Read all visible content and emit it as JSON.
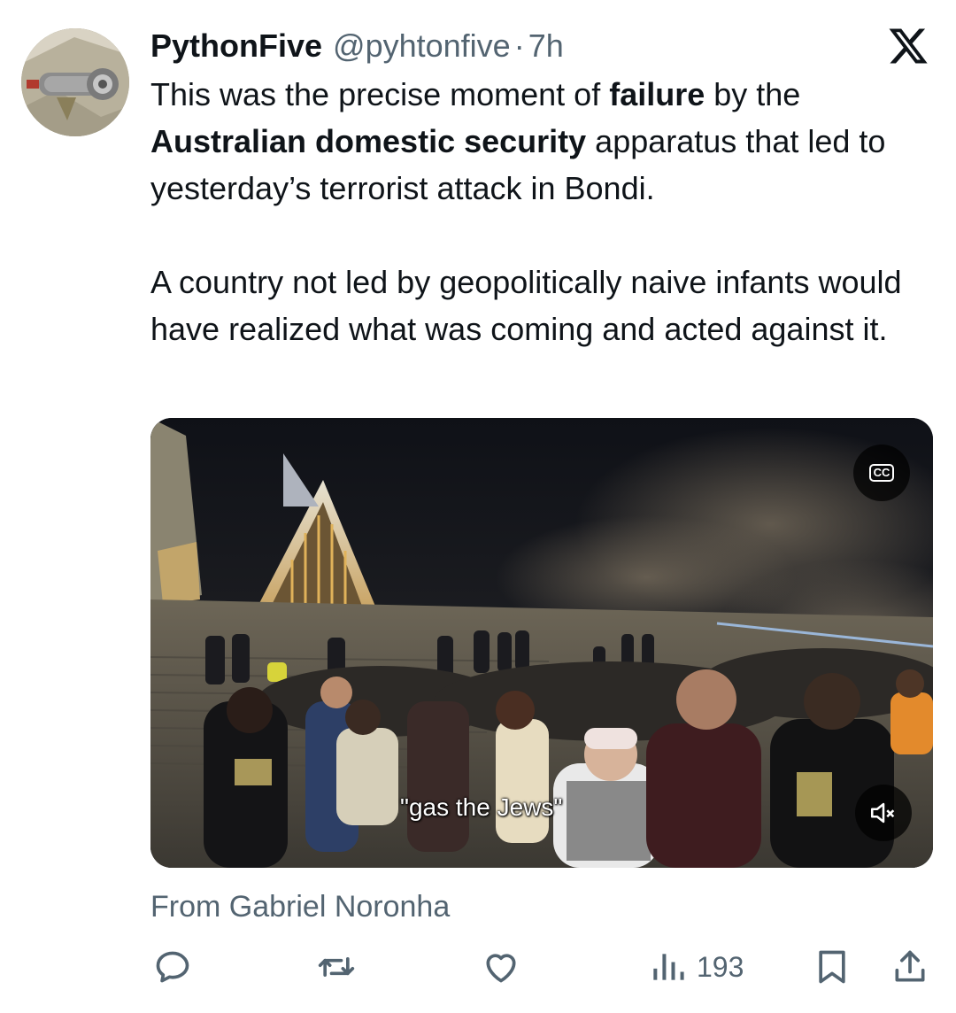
{
  "tweet": {
    "author_name": "PythonFive",
    "author_handle": "@pyhtonfive",
    "separator": "·",
    "time": "7h",
    "paragraph1": [
      {
        "text": "This was the precise moment of ",
        "bold": false
      },
      {
        "text": "failure",
        "bold": true
      },
      {
        "text": " by the ",
        "bold": false
      },
      {
        "text": "Australian domestic security",
        "bold": true
      },
      {
        "text": " apparatus that led to yesterday’s terrorist attack in Bondi.",
        "bold": false
      }
    ],
    "paragraph2": "A country not led by geopolitically naive infants would have realized what was coming and acted against it.",
    "source": "From Gabriel Noronha"
  },
  "media": {
    "subtitle": "\"gas the Jews\"",
    "cc_label": "CC"
  },
  "actions": {
    "views": "193"
  },
  "icons": {
    "logo": "x-logo-icon",
    "reply": "reply-icon",
    "retweet": "retweet-icon",
    "like": "heart-icon",
    "views": "views-bar-chart-icon",
    "bookmark": "bookmark-icon",
    "share": "share-icon",
    "captions": "closed-captions-icon",
    "mute": "muted-speaker-icon"
  }
}
